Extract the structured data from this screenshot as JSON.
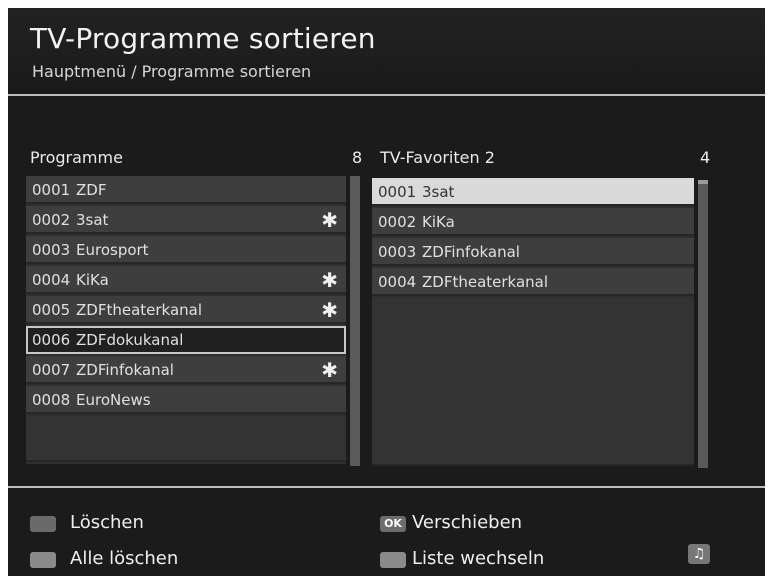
{
  "header": {
    "title": "TV-Programme sortieren",
    "breadcrumb": "Hauptmenü / Programme sortieren"
  },
  "left_list": {
    "title": "Programme",
    "count": "8",
    "items": [
      {
        "num": "0001",
        "name": "ZDF",
        "star": ""
      },
      {
        "num": "0002",
        "name": "3sat",
        "star": "✱"
      },
      {
        "num": "0003",
        "name": "Eurosport",
        "star": ""
      },
      {
        "num": "0004",
        "name": "KiKa",
        "star": "✱"
      },
      {
        "num": "0005",
        "name": "ZDFtheaterkanal",
        "star": "✱"
      },
      {
        "num": "0006",
        "name": "ZDFdokukanal",
        "star": ""
      },
      {
        "num": "0007",
        "name": "ZDFinfokanal",
        "star": "✱"
      },
      {
        "num": "0008",
        "name": "EuroNews",
        "star": ""
      }
    ]
  },
  "right_list": {
    "title": "TV-Favoriten 2",
    "count": "4",
    "items": [
      {
        "num": "0001",
        "name": "3sat"
      },
      {
        "num": "0002",
        "name": "KiKa"
      },
      {
        "num": "0003",
        "name": "ZDFinfokanal"
      },
      {
        "num": "0004",
        "name": "ZDFtheaterkanal"
      }
    ]
  },
  "footer": {
    "delete": "Löschen",
    "delete_all": "Alle löschen",
    "ok_key": "OK",
    "move": "Verschieben",
    "switch_list": "Liste wechseln"
  },
  "icons": {
    "music": "♫"
  }
}
